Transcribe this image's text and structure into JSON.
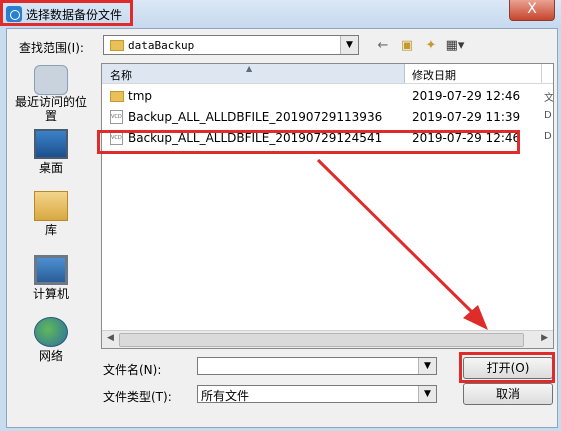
{
  "window": {
    "title": "选择数据备份文件",
    "close_label": "X"
  },
  "toolbar": {
    "look_in_label": "查找范围(I):",
    "look_in_value": "dataBackup",
    "back_icon": "back-arrow-icon",
    "up_icon": "up-folder-icon",
    "new_folder_icon": "new-folder-icon",
    "view_icon": "view-menu-icon"
  },
  "sidebar": {
    "items": [
      {
        "label": "最近访问的位置",
        "icon": "recent-places-icon"
      },
      {
        "label": "桌面",
        "icon": "desktop-icon"
      },
      {
        "label": "库",
        "icon": "library-icon"
      },
      {
        "label": "计算机",
        "icon": "computer-icon"
      },
      {
        "label": "网络",
        "icon": "network-icon"
      }
    ]
  },
  "filelist": {
    "columns": [
      "名称",
      "修改日期",
      ""
    ],
    "rows": [
      {
        "name": "tmp",
        "date": "2019-07-29 12:46",
        "type": "folder",
        "extra": "文"
      },
      {
        "name": "Backup_ALL_ALLDBFILE_20190729113936",
        "date": "2019-07-29 11:39",
        "type": "file",
        "extra": "D"
      },
      {
        "name": "Backup_ALL_ALLDBFILE_20190729124541",
        "date": "2019-07-29 12:46",
        "type": "file",
        "extra": "D"
      }
    ]
  },
  "footer": {
    "filename_label": "文件名(N):",
    "filename_value": "",
    "filetype_label": "文件类型(T):",
    "filetype_value": "所有文件",
    "open_label": "打开(O)",
    "cancel_label": "取消"
  },
  "colors": {
    "highlight": "#e02b2b",
    "titlebar": "#c6d9ee",
    "dialog_bg": "#f0f0f0"
  }
}
